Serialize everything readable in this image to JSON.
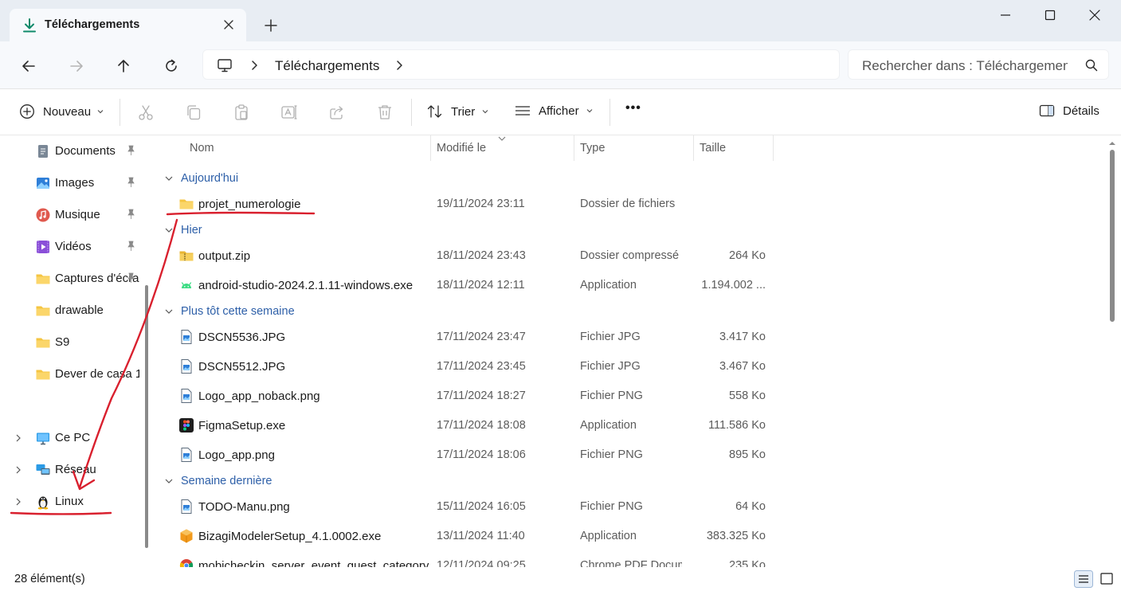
{
  "window": {
    "tab_title": "Téléchargements"
  },
  "navigation": {
    "breadcrumb_folder": "Téléchargements",
    "search_placeholder": "Rechercher dans : Téléchargements"
  },
  "toolbar": {
    "new_label": "Nouveau",
    "sort_label": "Trier",
    "view_label": "Afficher",
    "more_label": "•••",
    "details_label": "Détails"
  },
  "sidebar": {
    "quick_access": [
      {
        "label": "Documents",
        "icon": "documents-icon"
      },
      {
        "label": "Images",
        "icon": "images-icon"
      },
      {
        "label": "Musique",
        "icon": "music-icon"
      },
      {
        "label": "Vidéos",
        "icon": "videos-icon"
      },
      {
        "label": "Captures d'écran",
        "icon": "folder-icon"
      },
      {
        "label": "drawable",
        "icon": "folder-icon"
      },
      {
        "label": "S9",
        "icon": "folder-icon"
      },
      {
        "label": "Dever de casa 1",
        "icon": "folder-icon"
      }
    ],
    "locations": [
      {
        "label": "Ce PC",
        "icon": "this-pc-icon"
      },
      {
        "label": "Réseau",
        "icon": "network-icon"
      },
      {
        "label": "Linux",
        "icon": "linux-icon"
      }
    ]
  },
  "columns": {
    "name": "Nom",
    "modified": "Modifié le",
    "type": "Type",
    "size": "Taille"
  },
  "groups": [
    {
      "label": "Aujourd'hui",
      "files": [
        {
          "name": "projet_numerologie",
          "date": "19/11/2024 23:11",
          "type": "Dossier de fichiers",
          "size": "",
          "icon": "folder-icon"
        }
      ]
    },
    {
      "label": "Hier",
      "files": [
        {
          "name": "output.zip",
          "date": "18/11/2024 23:43",
          "type": "Dossier compressé",
          "size": "264 Ko",
          "icon": "zip-folder-icon"
        },
        {
          "name": "android-studio-2024.2.1.11-windows.exe",
          "date": "18/11/2024 12:11",
          "type": "Application",
          "size": "1.194.002 ...",
          "icon": "android-studio-icon"
        }
      ]
    },
    {
      "label": "Plus tôt cette semaine",
      "files": [
        {
          "name": "DSCN5536.JPG",
          "date": "17/11/2024 23:47",
          "type": "Fichier JPG",
          "size": "3.417 Ko",
          "icon": "image-file-icon"
        },
        {
          "name": "DSCN5512.JPG",
          "date": "17/11/2024 23:45",
          "type": "Fichier JPG",
          "size": "3.467 Ko",
          "icon": "image-file-icon"
        },
        {
          "name": "Logo_app_noback.png",
          "date": "17/11/2024 18:27",
          "type": "Fichier PNG",
          "size": "558 Ko",
          "icon": "image-file-icon"
        },
        {
          "name": "FigmaSetup.exe",
          "date": "17/11/2024 18:08",
          "type": "Application",
          "size": "111.586 Ko",
          "icon": "figma-icon"
        },
        {
          "name": "Logo_app.png",
          "date": "17/11/2024 18:06",
          "type": "Fichier PNG",
          "size": "895 Ko",
          "icon": "image-file-icon"
        }
      ]
    },
    {
      "label": "Semaine dernière",
      "files": [
        {
          "name": "TODO-Manu.png",
          "date": "15/11/2024 16:05",
          "type": "Fichier PNG",
          "size": "64 Ko",
          "icon": "image-file-icon"
        },
        {
          "name": "BizagiModelerSetup_4.1.0002.exe",
          "date": "13/11/2024 11:40",
          "type": "Application",
          "size": "383.325 Ko",
          "icon": "bizagi-icon"
        },
        {
          "name": "mobicheckin_server_event_guest_category",
          "date": "12/11/2024 09:25",
          "type": "Chrome PDF Document",
          "size": "235 Ko",
          "icon": "chrome-pdf-icon"
        }
      ]
    }
  ],
  "status": {
    "item_count": "28 élément(s)"
  },
  "colors": {
    "accent": "#2d5fa8",
    "annotation": "#d9202e",
    "folder": "#f5c542"
  }
}
